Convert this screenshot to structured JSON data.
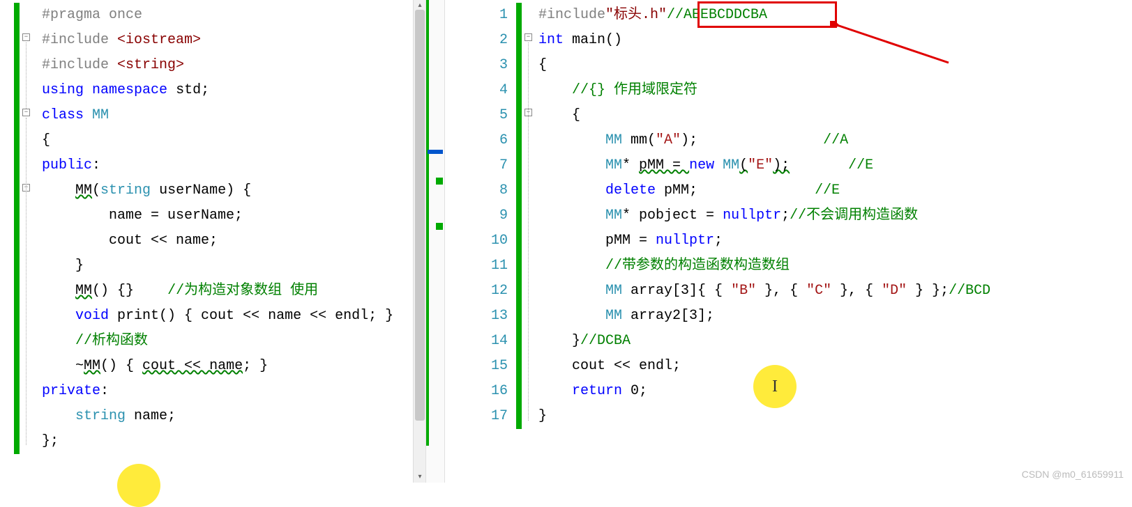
{
  "watermark": "CSDN @m0_61659911",
  "left_pane": {
    "lines": [
      {
        "tokens": [
          {
            "t": "#pragma",
            "c": "kw-pp"
          },
          {
            "t": " ",
            "c": ""
          },
          {
            "t": "once",
            "c": "kw-pp"
          }
        ]
      },
      {
        "tokens": [
          {
            "t": "#include",
            "c": "kw-pp"
          },
          {
            "t": " ",
            "c": ""
          },
          {
            "t": "<iostream>",
            "c": "kw-maroon"
          }
        ]
      },
      {
        "tokens": [
          {
            "t": "#include",
            "c": "kw-pp"
          },
          {
            "t": " ",
            "c": ""
          },
          {
            "t": "<string>",
            "c": "kw-maroon"
          }
        ]
      },
      {
        "tokens": [
          {
            "t": "using",
            "c": "kw-blue"
          },
          {
            "t": " ",
            "c": ""
          },
          {
            "t": "namespace",
            "c": "kw-blue"
          },
          {
            "t": " std;",
            "c": "kw-black"
          }
        ]
      },
      {
        "tokens": [
          {
            "t": "class",
            "c": "kw-blue"
          },
          {
            "t": " ",
            "c": ""
          },
          {
            "t": "MM",
            "c": "kw-type"
          }
        ]
      },
      {
        "tokens": [
          {
            "t": "{",
            "c": "kw-black"
          }
        ]
      },
      {
        "tokens": [
          {
            "t": "public",
            "c": "kw-blue"
          },
          {
            "t": ":",
            "c": "kw-black"
          }
        ]
      },
      {
        "tokens": [
          {
            "t": "    ",
            "c": ""
          },
          {
            "t": "MM",
            "c": "kw-black squiggle"
          },
          {
            "t": "(",
            "c": "kw-black"
          },
          {
            "t": "string",
            "c": "kw-type"
          },
          {
            "t": " userName) {",
            "c": "kw-black"
          }
        ]
      },
      {
        "tokens": [
          {
            "t": "        name = userName;",
            "c": "kw-black"
          }
        ]
      },
      {
        "tokens": [
          {
            "t": "        cout << name;",
            "c": "kw-black"
          }
        ],
        "highlight": true
      },
      {
        "tokens": [
          {
            "t": "    }",
            "c": "kw-black"
          }
        ]
      },
      {
        "tokens": [
          {
            "t": "    ",
            "c": ""
          },
          {
            "t": "MM",
            "c": "kw-black squiggle"
          },
          {
            "t": "() {}    ",
            "c": "kw-black"
          },
          {
            "t": "//为构造对象数组 使用",
            "c": "kw-cmt"
          }
        ]
      },
      {
        "tokens": [
          {
            "t": "    ",
            "c": ""
          },
          {
            "t": "void",
            "c": "kw-blue"
          },
          {
            "t": " print() { cout << name << endl; }",
            "c": "kw-black"
          }
        ]
      },
      {
        "tokens": [
          {
            "t": "    ",
            "c": ""
          },
          {
            "t": "//析构函数",
            "c": "kw-cmt"
          }
        ]
      },
      {
        "tokens": [
          {
            "t": "    ~",
            "c": "kw-black"
          },
          {
            "t": "MM",
            "c": "kw-black squiggle"
          },
          {
            "t": "() { ",
            "c": "kw-black"
          },
          {
            "t": "cout << name",
            "c": "kw-black squiggle"
          },
          {
            "t": "; }",
            "c": "kw-black"
          }
        ]
      },
      {
        "tokens": [
          {
            "t": "private",
            "c": "kw-blue"
          },
          {
            "t": ":",
            "c": "kw-black"
          }
        ]
      },
      {
        "tokens": [
          {
            "t": "    ",
            "c": ""
          },
          {
            "t": "string",
            "c": "kw-type"
          },
          {
            "t": " name;",
            "c": "kw-black"
          }
        ]
      },
      {
        "tokens": [
          {
            "t": "};",
            "c": "kw-black"
          }
        ]
      }
    ]
  },
  "right_pane": {
    "line_numbers": [
      "1",
      "2",
      "3",
      "4",
      "5",
      "6",
      "7",
      "8",
      "9",
      "10",
      "11",
      "12",
      "13",
      "14",
      "15",
      "16",
      "17"
    ],
    "lines": [
      {
        "tokens": [
          {
            "t": "#include",
            "c": "kw-pp"
          },
          {
            "t": "\"标头.h\"",
            "c": "kw-maroon"
          },
          {
            "t": "//AEEBCDDCBA",
            "c": "kw-cmt"
          }
        ]
      },
      {
        "tokens": [
          {
            "t": "int",
            "c": "kw-blue"
          },
          {
            "t": " main()",
            "c": "kw-black"
          }
        ]
      },
      {
        "tokens": [
          {
            "t": "{",
            "c": "kw-black"
          }
        ]
      },
      {
        "tokens": [
          {
            "t": "    ",
            "c": ""
          },
          {
            "t": "//{} 作用域限定符",
            "c": "kw-cmt"
          }
        ]
      },
      {
        "tokens": [
          {
            "t": "    {",
            "c": "kw-black"
          }
        ]
      },
      {
        "tokens": [
          {
            "t": "        ",
            "c": ""
          },
          {
            "t": "MM",
            "c": "kw-type"
          },
          {
            "t": " mm(",
            "c": "kw-black"
          },
          {
            "t": "\"A\"",
            "c": "kw-str"
          },
          {
            "t": ");               ",
            "c": "kw-black"
          },
          {
            "t": "//A",
            "c": "kw-cmt"
          }
        ]
      },
      {
        "tokens": [
          {
            "t": "        ",
            "c": ""
          },
          {
            "t": "MM",
            "c": "kw-type"
          },
          {
            "t": "* ",
            "c": "kw-black"
          },
          {
            "t": "pMM = ",
            "c": "kw-black squiggle"
          },
          {
            "t": "new",
            "c": "kw-blue"
          },
          {
            "t": " ",
            "c": ""
          },
          {
            "t": "MM",
            "c": "kw-type"
          },
          {
            "t": "(",
            "c": "kw-black squiggle"
          },
          {
            "t": "\"E\"",
            "c": "kw-str"
          },
          {
            "t": ");",
            "c": "kw-black squiggle"
          },
          {
            "t": "       ",
            "c": ""
          },
          {
            "t": "//E",
            "c": "kw-cmt"
          }
        ]
      },
      {
        "tokens": [
          {
            "t": "        ",
            "c": ""
          },
          {
            "t": "delete",
            "c": "kw-blue"
          },
          {
            "t": " pMM;              ",
            "c": "kw-black"
          },
          {
            "t": "//E",
            "c": "kw-cmt"
          }
        ]
      },
      {
        "tokens": [
          {
            "t": "        ",
            "c": ""
          },
          {
            "t": "MM",
            "c": "kw-type"
          },
          {
            "t": "* pobject = ",
            "c": "kw-black"
          },
          {
            "t": "nullptr",
            "c": "kw-blue"
          },
          {
            "t": ";",
            "c": "kw-black"
          },
          {
            "t": "//不会调用构造函数",
            "c": "kw-cmt"
          }
        ]
      },
      {
        "tokens": [
          {
            "t": "        pMM = ",
            "c": "kw-black"
          },
          {
            "t": "nullptr",
            "c": "kw-blue"
          },
          {
            "t": ";",
            "c": "kw-black"
          }
        ]
      },
      {
        "tokens": [
          {
            "t": "        ",
            "c": ""
          },
          {
            "t": "//带参数的构造函数构造数组",
            "c": "kw-cmt"
          }
        ]
      },
      {
        "tokens": [
          {
            "t": "        ",
            "c": ""
          },
          {
            "t": "MM",
            "c": "kw-type"
          },
          {
            "t": " array[3]{ { ",
            "c": "kw-black"
          },
          {
            "t": "\"B\"",
            "c": "kw-str"
          },
          {
            "t": " }, { ",
            "c": "kw-black"
          },
          {
            "t": "\"C\"",
            "c": "kw-str"
          },
          {
            "t": " }, { ",
            "c": "kw-black"
          },
          {
            "t": "\"D\"",
            "c": "kw-str"
          },
          {
            "t": " } };",
            "c": "kw-black"
          },
          {
            "t": "//BCD",
            "c": "kw-cmt"
          }
        ]
      },
      {
        "tokens": [
          {
            "t": "        ",
            "c": ""
          },
          {
            "t": "MM",
            "c": "kw-type"
          },
          {
            "t": " array2[3];",
            "c": "kw-black"
          }
        ]
      },
      {
        "tokens": [
          {
            "t": "    }",
            "c": "kw-black"
          },
          {
            "t": "//DCBA",
            "c": "kw-cmt"
          }
        ]
      },
      {
        "tokens": [
          {
            "t": "    cout << endl;",
            "c": "kw-black"
          }
        ]
      },
      {
        "tokens": [
          {
            "t": "    ",
            "c": ""
          },
          {
            "t": "return",
            "c": "kw-blue"
          },
          {
            "t": " 0;",
            "c": "kw-black"
          }
        ]
      },
      {
        "tokens": [
          {
            "t": "}",
            "c": "kw-black"
          }
        ]
      }
    ]
  },
  "cursor_label": "I"
}
